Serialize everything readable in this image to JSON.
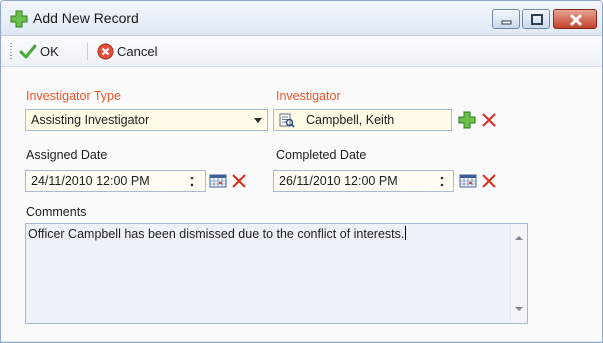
{
  "window": {
    "title": "Add New Record",
    "icon": "green-plus-icon",
    "controls": [
      "minimize-icon",
      "maximize-icon",
      "close-icon"
    ]
  },
  "toolbar": {
    "ok_label": "OK",
    "cancel_label": "Cancel",
    "ok_icon": "checkmark-icon",
    "cancel_icon": "red-x-circle-icon"
  },
  "form": {
    "investigator_type": {
      "label": "Investigator Type",
      "value": "Assisting Investigator"
    },
    "investigator": {
      "label": "Investigator",
      "value": "Campbell, Keith"
    },
    "assigned_date": {
      "label": "Assigned Date",
      "value": "24/11/2010 12:00 PM"
    },
    "completed_date": {
      "label": "Completed Date",
      "value": "26/11/2010 12:00 PM"
    },
    "comments": {
      "label": "Comments",
      "value": "Officer Campbell has been dismissed due to the conflict of interests."
    }
  },
  "colors": {
    "required_label": "#e8572b",
    "field_bg": "#fffbe6",
    "border": "#a9bad0"
  }
}
